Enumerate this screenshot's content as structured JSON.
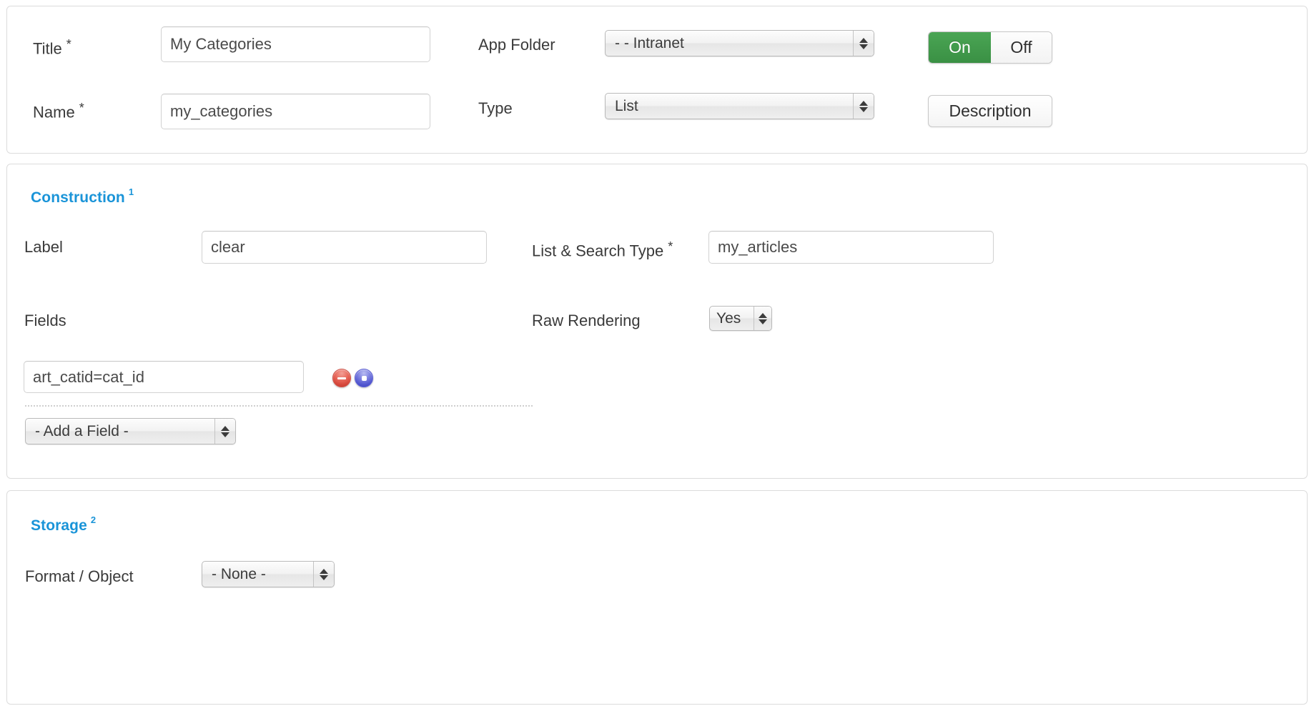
{
  "header_panel": {
    "title_field": {
      "label": "Title",
      "required_mark": "*",
      "value": "My Categories"
    },
    "name_field": {
      "label": "Name",
      "required_mark": "*",
      "value": "my_categories"
    },
    "app_folder": {
      "label": "App Folder",
      "value": "- - Intranet"
    },
    "type": {
      "label": "Type",
      "value": "List"
    },
    "toggle": {
      "on_label": "On",
      "off_label": "Off",
      "state": "On",
      "on_color": "#3f9848"
    },
    "description_button": {
      "label": "Description"
    }
  },
  "construction_panel": {
    "section_title": "Construction",
    "section_number": "1",
    "label_field": {
      "label": "Label",
      "value": "clear"
    },
    "list_search_type": {
      "label": "List & Search Type",
      "required_mark": "*",
      "value": "my_articles"
    },
    "fields": {
      "label": "Fields",
      "rows": [
        {
          "value": "art_catid=cat_id"
        }
      ],
      "add_field_select": {
        "value": "- Add a Field -"
      }
    },
    "raw_rendering": {
      "label": "Raw Rendering",
      "value": "Yes"
    }
  },
  "storage_panel": {
    "section_title": "Storage",
    "section_number": "2",
    "format_object": {
      "label": "Format / Object",
      "value": "- None -"
    }
  },
  "theme": {
    "accent": "#1a94d8",
    "panel_border": "#dcdcdc",
    "text": "#3a3a3a"
  }
}
